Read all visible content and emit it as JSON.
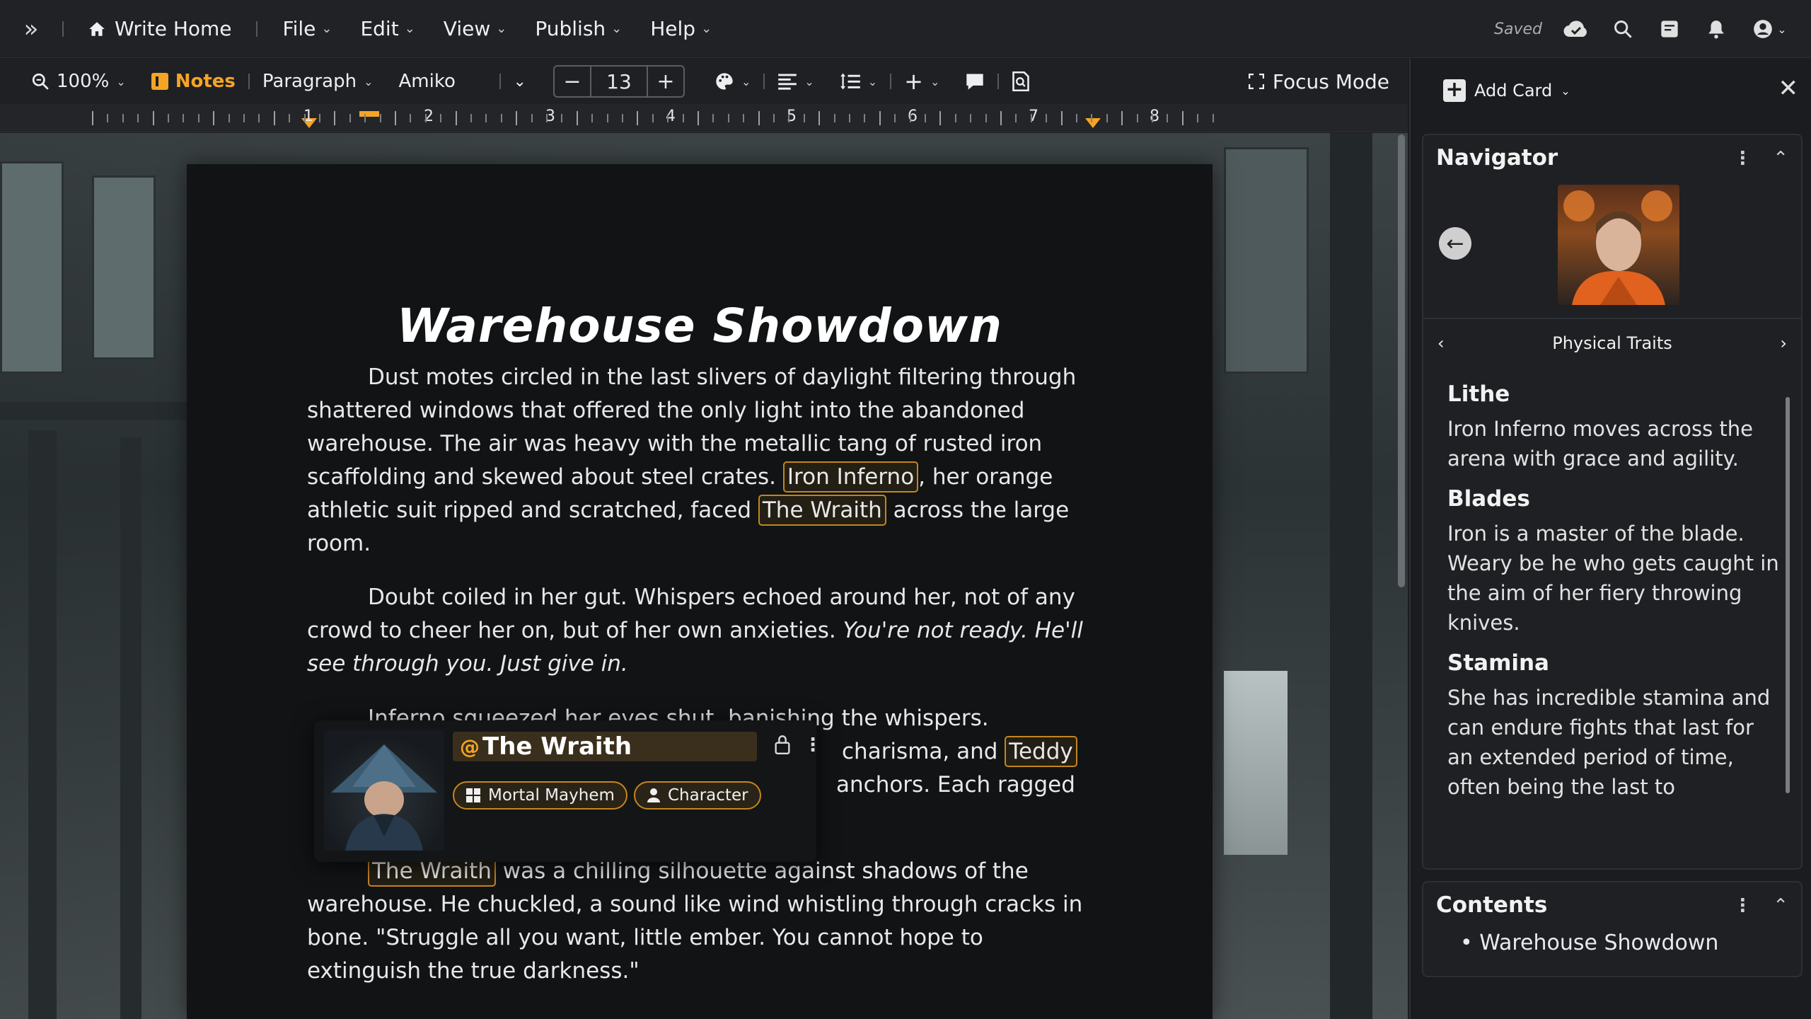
{
  "menubar": {
    "home": "Write Home",
    "menus": [
      "File",
      "Edit",
      "View",
      "Publish",
      "Help"
    ],
    "saved": "Saved"
  },
  "toolbar": {
    "zoom": "100%",
    "notes": "Notes",
    "paragraph": "Paragraph",
    "font": "Amiko",
    "font_size": "13",
    "focus_mode": "Focus Mode"
  },
  "ruler": {
    "numbers": [
      "1",
      "2",
      "3",
      "4",
      "5",
      "6",
      "7",
      "8"
    ]
  },
  "document": {
    "title": "Warehouse Showdown",
    "p1_a": "Dust motes circled in the last slivers of daylight filtering through shattered windows that offered the only light into the abandoned warehouse. The air was heavy with the metallic tang of rusted iron scaffolding and skewed about steel crates.",
    "p1_tag1": "Iron Inferno",
    "p1_b": ", her orange athletic suit ripped and scratched, faced",
    "p1_tag2": "The Wraith",
    "p1_c": "across the large room.",
    "p2_a": "Doubt coiled in her gut. Whispers echoed around her, not of any crowd to cheer her on, but of her own anxieties.",
    "p2_italic": "You're not ready. He'll see through you. Just give in.",
    "p3_line1": "Inferno squeezed her eyes shut, banishing the whispers.",
    "p3_line2_right": "charisma, and",
    "p3_tag": "Teddy",
    "p3_line3_right": "anchors. Each ragged",
    "p4_tag": "The Wraith",
    "p4_text": "was a chilling silhouette against shadows of the warehouse. He chuckled, a sound like wind whistling through cracks in bone. \"Struggle all you want, little ember. You cannot hope to extinguish the true darkness.\""
  },
  "hover_card": {
    "title": "The Wraith",
    "chips": [
      "Mortal Mayhem",
      "Character"
    ]
  },
  "right_panel": {
    "add_card": "Add Card",
    "navigator": {
      "title": "Navigator",
      "section": "Physical Traits",
      "traits": [
        {
          "heading": "Lithe",
          "body": "Iron Inferno moves across the arena with grace and agility."
        },
        {
          "heading": "Blades",
          "body": "Iron is a master of the blade. Weary be he who gets caught in the aim of her fiery throwing knives."
        },
        {
          "heading": "Stamina",
          "body": "She has incredible stamina and can endure fights that last for an extended period of time, often being the last to"
        }
      ]
    },
    "contents": {
      "title": "Contents",
      "items": [
        "Warehouse Showdown"
      ]
    }
  },
  "colors": {
    "accent": "#f5a524",
    "tag_border": "#c4861c"
  }
}
